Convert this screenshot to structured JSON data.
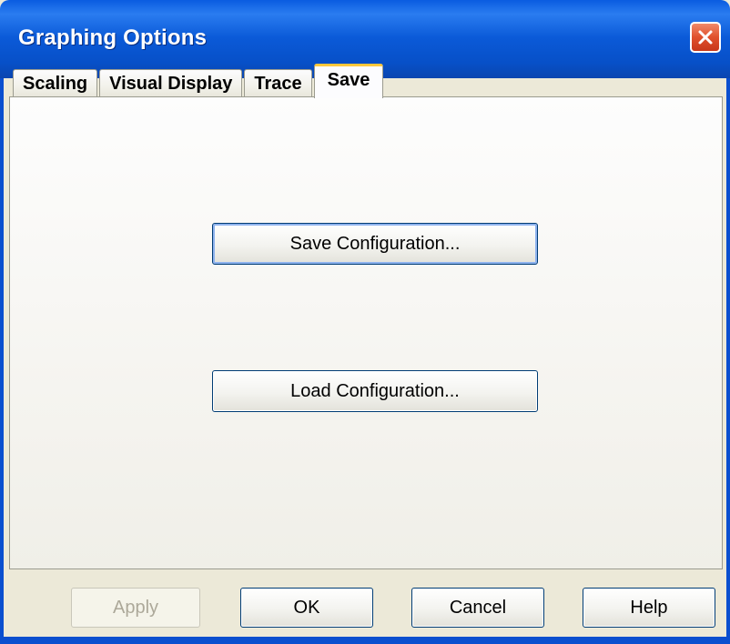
{
  "window": {
    "title": "Graphing Options",
    "close_icon": "close-icon"
  },
  "tabs": [
    {
      "label": "Scaling",
      "active": false
    },
    {
      "label": "Visual Display",
      "active": false
    },
    {
      "label": "Trace",
      "active": false
    },
    {
      "label": "Save",
      "active": true
    }
  ],
  "panel": {
    "save_config_label": "Save Configuration...",
    "load_config_label": "Load Configuration..."
  },
  "footer": {
    "apply_label": "Apply",
    "apply_enabled": false,
    "ok_label": "OK",
    "cancel_label": "Cancel",
    "help_label": "Help"
  },
  "colors": {
    "titlebar": "#0a5ce0",
    "active_tab_accent": "#ffc83c",
    "close_button": "#e0502c"
  }
}
